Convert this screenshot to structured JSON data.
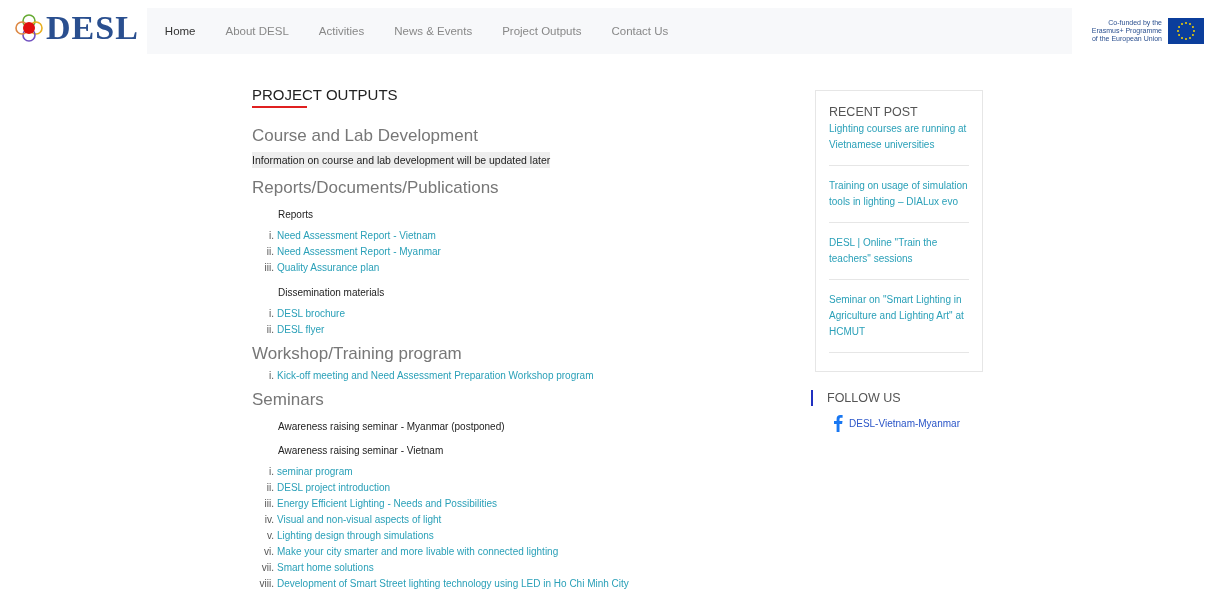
{
  "header": {
    "logo": "DESL",
    "nav": [
      {
        "label": "Home",
        "selected": true
      },
      {
        "label": "About DESL",
        "selected": false
      },
      {
        "label": "Activities",
        "selected": false
      },
      {
        "label": "News & Events",
        "selected": false
      },
      {
        "label": "Project Outputs",
        "selected": false
      },
      {
        "label": "Contact Us",
        "selected": false
      }
    ],
    "funding": [
      "Co-funded by the",
      "Erasmus+ Programme",
      "of the European Union"
    ]
  },
  "page_title": "PROJECT OUTPUTS",
  "sections": [
    {
      "heading": "Course and Lab Development",
      "blocks": [
        {
          "kind": "note",
          "text": "Information on course and lab development will be updated later"
        }
      ]
    },
    {
      "heading": "Reports/Documents/Publications",
      "blocks": [
        {
          "kind": "label",
          "text": "Reports"
        },
        {
          "kind": "list",
          "items": [
            {
              "marker": "i.",
              "text": "Need Assessment Report - Vietnam"
            },
            {
              "marker": "ii.",
              "text": "Need Assessment Report - Myanmar"
            },
            {
              "marker": "iii.",
              "text": "Quality Assurance plan"
            }
          ]
        },
        {
          "kind": "label",
          "text": "Dissemination materials"
        },
        {
          "kind": "list",
          "items": [
            {
              "marker": "i.",
              "text": "DESL brochure"
            },
            {
              "marker": "ii.",
              "text": "DESL flyer"
            }
          ]
        }
      ]
    },
    {
      "heading": "Workshop/Training program",
      "blocks": [
        {
          "kind": "list",
          "items": [
            {
              "marker": "i.",
              "text": "Kick-off meeting and Need Assessment Preparation Workshop program"
            }
          ]
        }
      ]
    },
    {
      "heading": "Seminars",
      "blocks": [
        {
          "kind": "label",
          "text": "Awareness raising seminar - Myanmar (postponed)"
        },
        {
          "kind": "label",
          "text": "Awareness raising seminar - Vietnam"
        },
        {
          "kind": "list",
          "items": [
            {
              "marker": "i.",
              "text": "seminar program"
            },
            {
              "marker": "ii.",
              "text": "DESL project introduction"
            },
            {
              "marker": "iii.",
              "text": "Energy Efficient Lighting - Needs and Possibilities"
            },
            {
              "marker": "iv.",
              "text": "Visual and non-visual aspects of light"
            },
            {
              "marker": "v.",
              "text": "Lighting design through simulations"
            },
            {
              "marker": "vi.",
              "text": "Make your city smarter and more livable with connected lighting"
            },
            {
              "marker": "vii.",
              "text": "Smart home solutions"
            },
            {
              "marker": "viii.",
              "text": "Development of Smart Street lighting technology using LED in Ho Chi Minh City"
            }
          ]
        }
      ]
    }
  ],
  "recent_post": {
    "title": "RECENT POST",
    "posts": [
      "Lighting courses are running at Vietnamese universities",
      "Training on usage of simulation tools in lighting – DIALux evo",
      "DESL | Online \"Train the teachers\" sessions",
      "Seminar on \"Smart Lighting in Agriculture and Lighting Art\" at HCMUT"
    ]
  },
  "follow_us": {
    "title": "FOLLOW US",
    "link": "DESL-Vietnam-Myanmar"
  }
}
